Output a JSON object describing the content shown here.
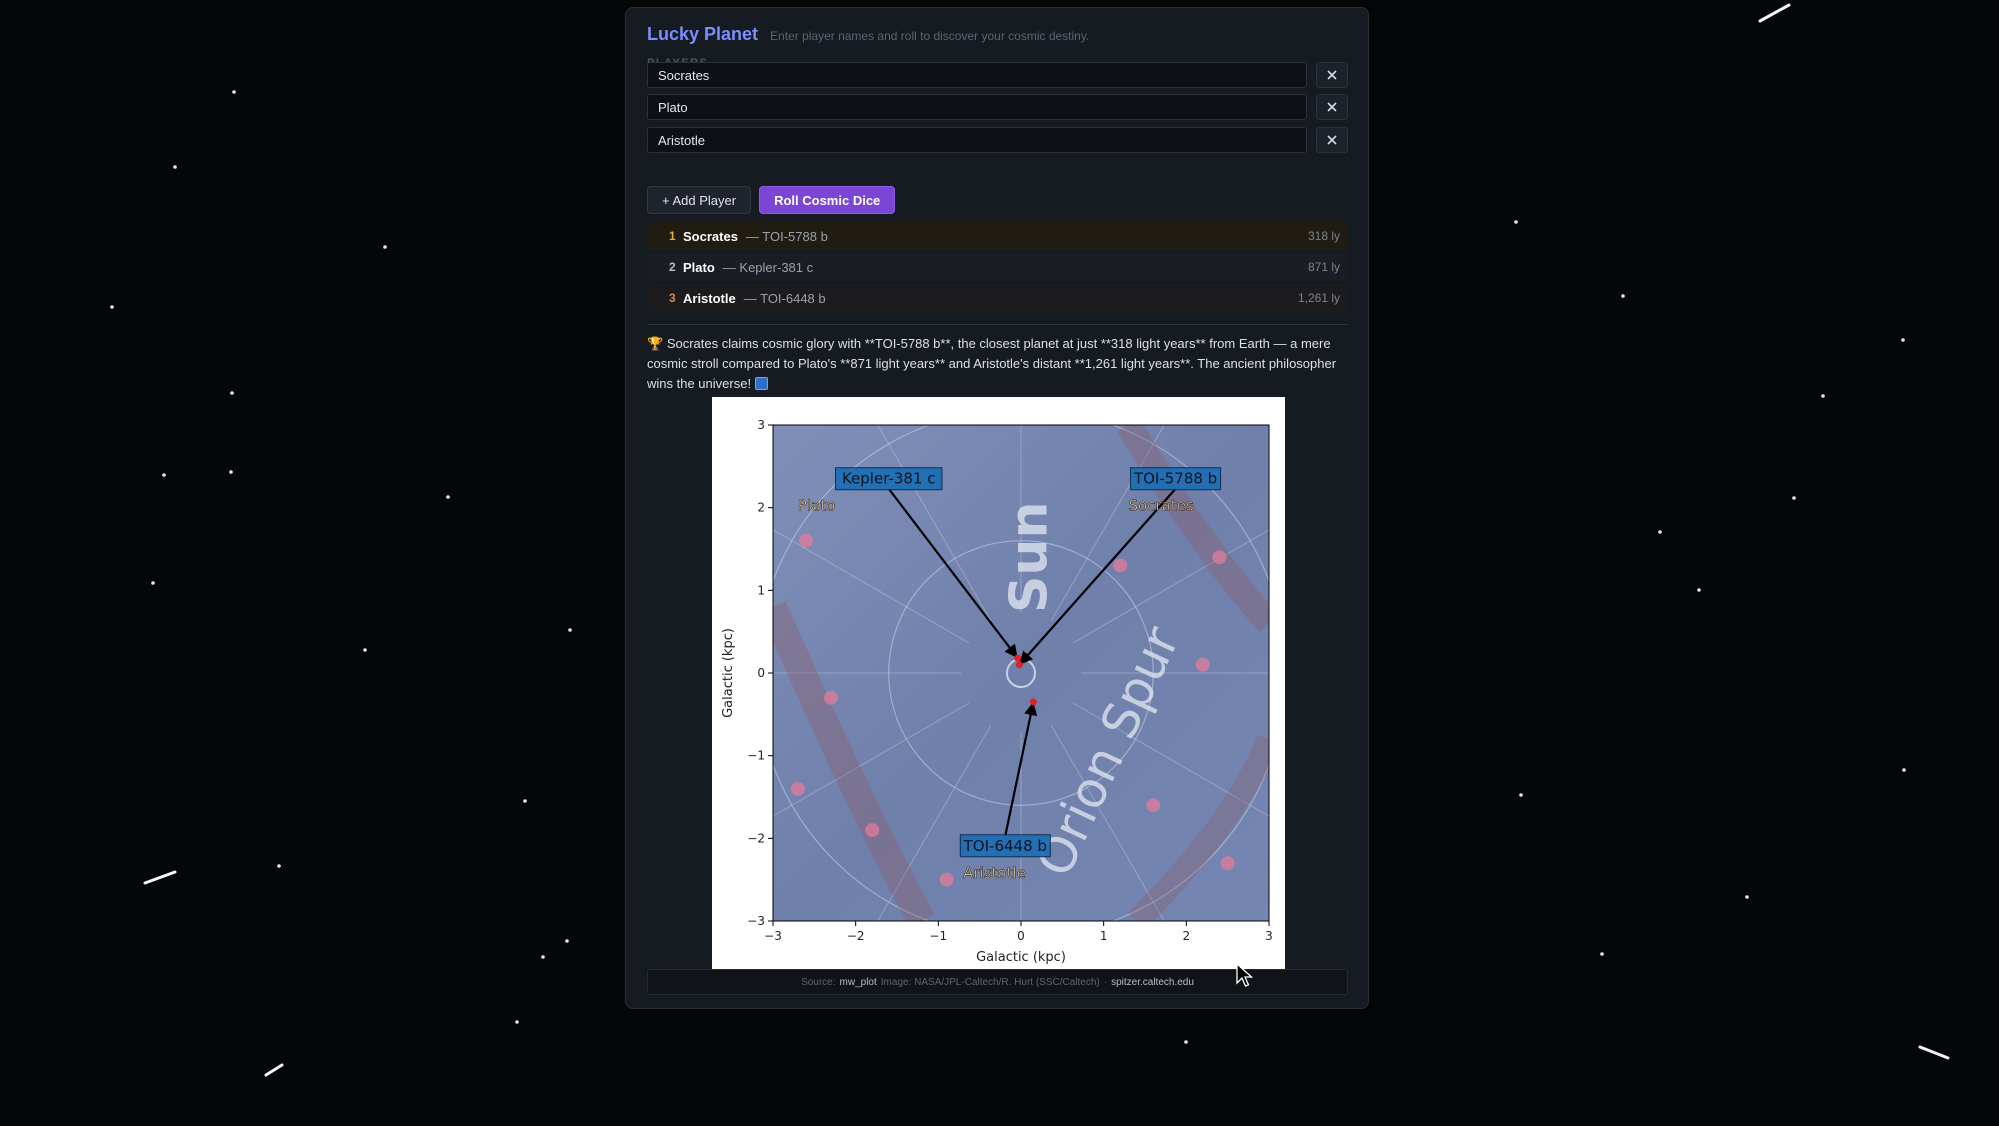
{
  "app": {
    "title": "Lucky Planet",
    "subtitle": "Enter player names and roll to discover your cosmic destiny."
  },
  "players_section": {
    "label": "PLAYERS",
    "players": [
      {
        "name": "Socrates"
      },
      {
        "name": "Plato"
      },
      {
        "name": "Aristotle"
      }
    ],
    "remove_label": "✕"
  },
  "buttons": {
    "add_player": "+ Add Player",
    "roll": "Roll Cosmic Dice"
  },
  "results": [
    {
      "rank": "1",
      "name": "Socrates",
      "planet": "— TOI-5788 b",
      "distance": "318 ly",
      "rank_color": "#e7a93a",
      "bg": "#211c12"
    },
    {
      "rank": "2",
      "name": "Plato",
      "planet": "— Kepler-381 c",
      "distance": "871 ly",
      "rank_color": "#b9bcc3",
      "bg": "#1a1d23"
    },
    {
      "rank": "3",
      "name": "Aristotle",
      "planet": "— TOI-6448 b",
      "distance": "1,261 ly",
      "rank_color": "#d98a4c",
      "bg": "#1c1b1d"
    }
  ],
  "narration": {
    "trophy": "🏆",
    "text": "Socrates claims cosmic glory with **TOI-5788 b**, the closest planet at just **318 light years** from Earth — a mere cosmic stroll compared to Plato's **871 light years** and Aristotle's distant **1,261 light years**. The ancient philosopher wins the universe!"
  },
  "chart_data": {
    "type": "scatter",
    "xlabel": "Galactic (kpc)",
    "ylabel": "Galactic (kpc)",
    "xlim": [
      -3,
      3
    ],
    "ylim": [
      -3,
      3
    ],
    "xticks": [
      "−3",
      "−2",
      "−1",
      "0",
      "1",
      "2",
      "3"
    ],
    "yticks": [
      "−3",
      "−2",
      "−1",
      "0",
      "1",
      "2",
      "3"
    ],
    "background_labels": [
      "Sun",
      "Orion Spur"
    ],
    "points": [
      {
        "planet": "Kepler-381 c",
        "player": "Plato",
        "x": -0.04,
        "y": 0.18
      },
      {
        "planet": "TOI-5788 b",
        "player": "Socrates",
        "x": -0.02,
        "y": 0.1
      },
      {
        "planet": "TOI-6448 b",
        "player": "Aristotle",
        "x": 0.15,
        "y": -0.35
      }
    ],
    "grid": false
  },
  "source": {
    "prefix": "Source:",
    "lib": "mw_plot",
    "credit": "Image: NASA/JPL-Caltech/R. Hurt (SSC/Caltech)",
    "sep": "·",
    "site": "spitzer.caltech.edu"
  },
  "colors": {
    "accent": "#7b8cff",
    "roll_button": "#7b45d6",
    "callout": "#1f6eb5"
  }
}
